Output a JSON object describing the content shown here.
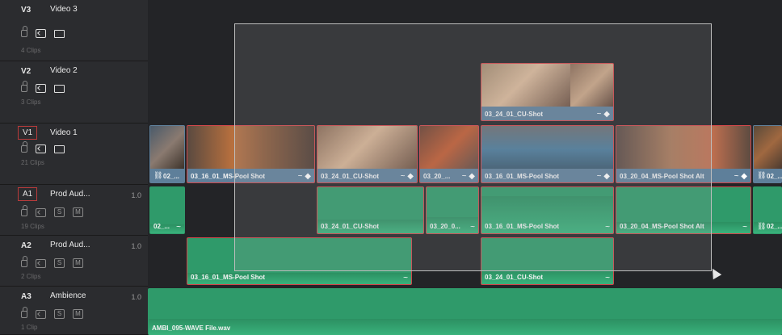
{
  "tracks": {
    "v3": {
      "id": "V3",
      "name": "Video 3",
      "clips": "4 Clips"
    },
    "v2": {
      "id": "V2",
      "name": "Video 2",
      "clips": "3 Clips"
    },
    "v1": {
      "id": "V1",
      "name": "Video 1",
      "clips": "21 Clips"
    },
    "a1": {
      "id": "A1",
      "name": "Prod Aud...",
      "volume": "1.0",
      "clips": "19 Clips"
    },
    "a2": {
      "id": "A2",
      "name": "Prod Aud...",
      "volume": "1.0",
      "clips": "2 Clips"
    },
    "a3": {
      "id": "A3",
      "name": "Ambience",
      "volume": "1.0",
      "clips": "1 Clip"
    }
  },
  "buttons": {
    "solo": "S",
    "mute": "M"
  },
  "video_clips": {
    "v2_1": "03_24_01_CU-Shot",
    "v1_0": "02_...",
    "v1_1": "03_16_01_MS-Pool Shot",
    "v1_2": "03_24_01_CU-Shot",
    "v1_3": "03_20_...",
    "v1_4": "03_16_01_MS-Pool Shot",
    "v1_5": "03_20_04_MS-Pool Shot Alt",
    "v1_6": "02_..."
  },
  "audio_clips": {
    "a1_0": "02_...",
    "a1_2": "03_24_01_CU-Shot",
    "a1_3": "03_20_0...",
    "a1_4": "03_16_01_MS-Pool Shot",
    "a1_5": "03_20_04_MS-Pool Shot Alt",
    "a1_6": "02_...",
    "a2_1": "03_16_01_MS-Pool Shot",
    "a2_2": "03_24_01_CU-Shot",
    "a3_1": "AMBI_095-WAVE File.wav"
  },
  "icons": {
    "fx": "~",
    "keyframe": "◆",
    "link": "⛓"
  },
  "colors": {
    "video_label": "#5e7f9a",
    "audio": "#2f9a6a",
    "selected_border": "#d0464a",
    "track_header": "#2b2c2f"
  }
}
